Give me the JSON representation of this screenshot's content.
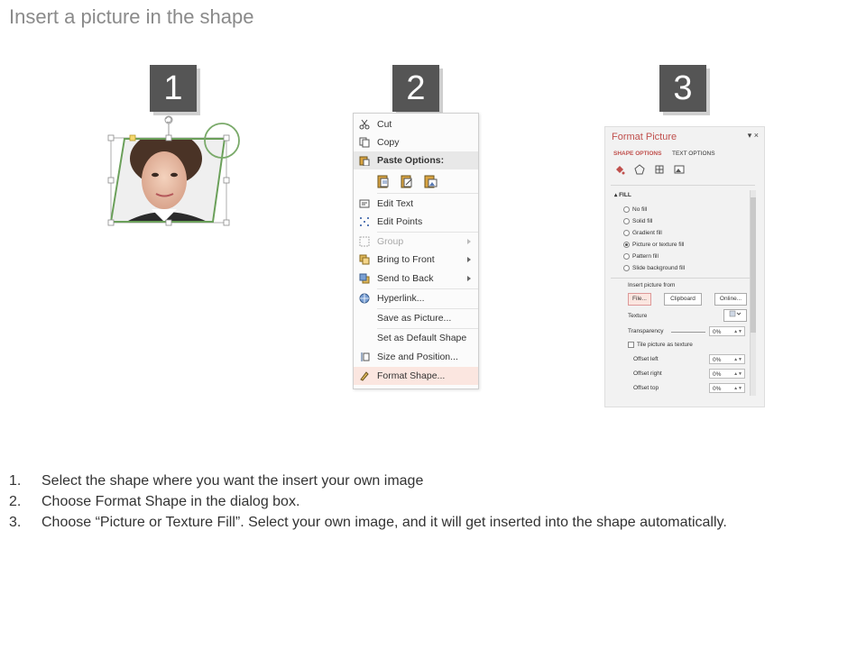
{
  "title": "Insert a picture in the shape",
  "steps": [
    "1",
    "2",
    "3"
  ],
  "context_menu": {
    "items": [
      {
        "label": "Cut",
        "icon": "scissors-icon"
      },
      {
        "label": "Copy",
        "icon": "copy-icon"
      },
      {
        "label": "Paste Options:",
        "icon": "paste-icon"
      },
      {
        "label": "Edit Text",
        "icon": "edit-text-icon"
      },
      {
        "label": "Edit Points",
        "icon": "edit-points-icon"
      },
      {
        "label": "Group",
        "icon": "group-icon",
        "disabled": true,
        "submenu": true
      },
      {
        "label": "Bring to Front",
        "icon": "bring-to-front-icon",
        "submenu": true
      },
      {
        "label": "Send to Back",
        "icon": "send-to-back-icon",
        "submenu": true
      },
      {
        "label": "Hyperlink...",
        "icon": "hyperlink-icon"
      },
      {
        "label": "Save as Picture...",
        "icon": ""
      },
      {
        "label": "Set as Default Shape",
        "icon": ""
      },
      {
        "label": "Size and Position...",
        "icon": "size-position-icon"
      },
      {
        "label": "Format Shape...",
        "icon": "format-shape-icon",
        "highlighted": true
      }
    ]
  },
  "format_pane": {
    "title": "Format Picture",
    "close": "▾ ×",
    "tabs": [
      "SHAPE OPTIONS",
      "TEXT OPTIONS"
    ],
    "section": "▴ FILL",
    "fill_options": [
      "No fill",
      "Solid fill",
      "Gradient fill",
      "Picture or texture fill",
      "Pattern fill",
      "Slide background fill"
    ],
    "selected_fill": "Picture or texture fill",
    "insert_from_label": "Insert picture from",
    "buttons": {
      "file": "File...",
      "clipboard": "Clipboard",
      "online": "Online..."
    },
    "texture_label": "Texture",
    "transparency_label": "Transparency",
    "transparency_value": "0%",
    "tile_label": "Tile picture as texture",
    "offsets": [
      {
        "label": "Offset left",
        "value": "0%"
      },
      {
        "label": "Offset right",
        "value": "0%"
      },
      {
        "label": "Offset top",
        "value": "0%"
      }
    ]
  },
  "instructions": [
    {
      "num": "1.",
      "text": "Select the shape where you want the insert your own image"
    },
    {
      "num": "2.",
      "text": "Choose Format Shape in the dialog box."
    },
    {
      "num": "3.",
      "text": "Choose “Picture or Texture Fill”. Select your own image, and it will get inserted into the shape automatically."
    }
  ],
  "colors": {
    "badge": "#555555",
    "accent": "#c0504d",
    "shape_outline": "#6ba05a"
  }
}
